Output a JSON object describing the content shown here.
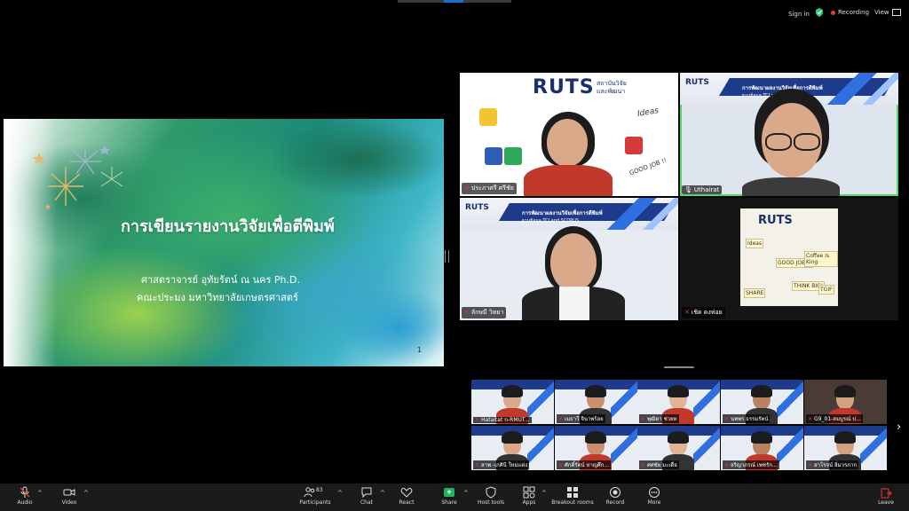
{
  "topbar": {
    "sign_in": "Sign in",
    "recording": "Recording",
    "view": "View"
  },
  "slide": {
    "title": "การเขียนรายงานวิจัยเพื่อตีพิมพ์",
    "author": "ศาสตราจารย์ อุทัยรัตน์ ณ นคร Ph.D.",
    "affiliation": "คณะประมง มหาวิทยาลัยเกษตรศาสตร์",
    "page": "1"
  },
  "gallery": {
    "tiles": [
      {
        "name": "ประภาศรี ศรีชัย",
        "muted": true
      },
      {
        "name": "Uthairat",
        "muted": false
      },
      {
        "name": "ลักษมี วิทยา",
        "muted": true
      },
      {
        "name": "เชิด ดงห่อย",
        "muted": true
      }
    ],
    "logo_text": "RUTS",
    "institute_line1": "สถาบันวิจัย",
    "institute_line2": "และพัฒนา",
    "banner_title": "การพัฒนาผลงานวิจัยเพื่อการตีพิมพ์",
    "banner_sub": "ฐานข้อมูล TCI and SCOPUS",
    "poster_notes": [
      "GOOD JOB !!",
      "THINK BIG!",
      "TGIF",
      "Ideas",
      "Coffee is King",
      "SHARE"
    ]
  },
  "thumbnails": [
    {
      "name": "Hataitat n-RMUT...",
      "muted": true
    },
    {
      "name": "เมธาวี จินาพร้อย",
      "muted": true
    },
    {
      "name": "พุฒิดา ช่วยท",
      "muted": true
    },
    {
      "name": "นพพร ธรรมรัตน์",
      "muted": true
    },
    {
      "name": "G9_01-สมบูรณ์ ป...",
      "muted": true
    },
    {
      "name": "สาพ -เกศินี ใหม่แต่ง",
      "muted": true
    },
    {
      "name": "ศักดิ์รัตน์ หาญศึก...",
      "muted": true
    },
    {
      "name": "ศศชัย มะเดื่อ",
      "muted": true
    },
    {
      "name": "จริญาภรณ์ เพชรัก...",
      "muted": true
    },
    {
      "name": "สาโรจน์ อิ่มวรภาก",
      "muted": true
    }
  ],
  "toolbar": {
    "audio": "Audio",
    "video": "Video",
    "participants": "Participants",
    "participants_count": "83",
    "chat": "Chat",
    "react": "React",
    "share": "Share",
    "host_tools": "Host tools",
    "apps": "Apps",
    "breakout_rooms": "Breakout rooms",
    "record": "Record",
    "more": "More",
    "leave": "Leave"
  },
  "colors": {
    "accent_green": "#4cd964",
    "mute_red": "#e53935",
    "share_green": "#21b15f",
    "leave_red": "#e53935"
  }
}
